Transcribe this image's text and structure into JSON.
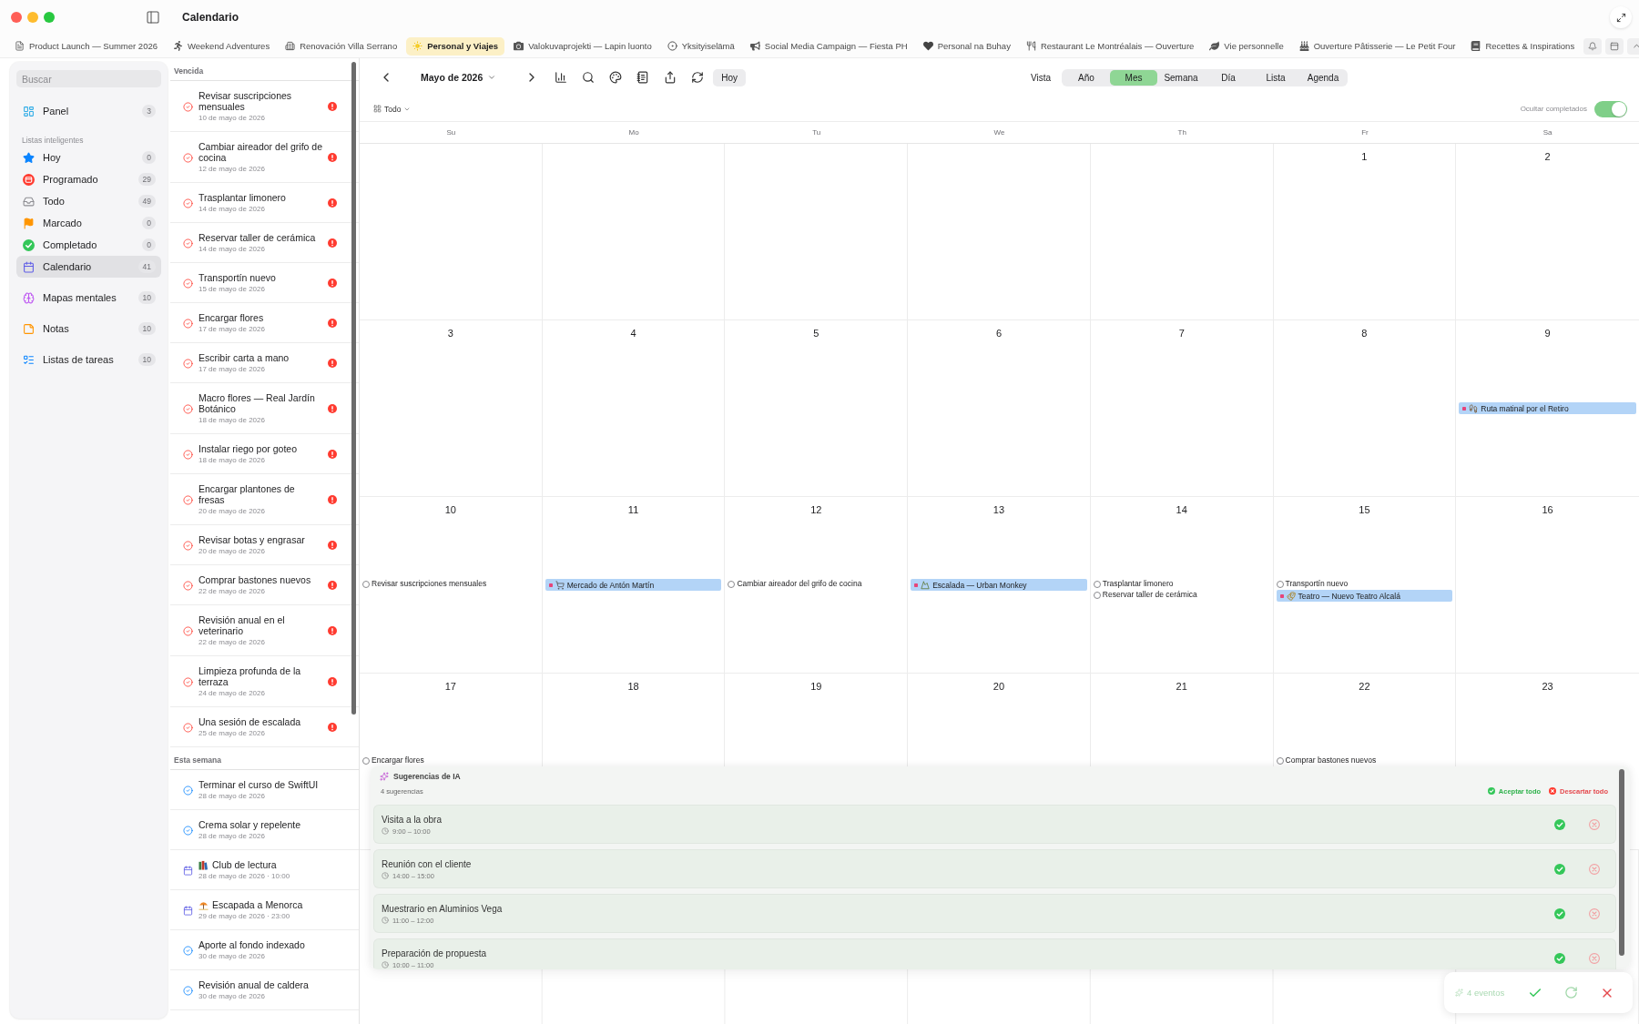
{
  "window": {
    "title": "Calendario"
  },
  "tabs": [
    {
      "label": "Product Launch — Summer 2026",
      "kind": "document",
      "selected": false
    },
    {
      "label": "Weekend Adventures",
      "kind": "runner",
      "selected": false
    },
    {
      "label": "Renovación Villa Serrano",
      "kind": "house",
      "selected": false
    },
    {
      "label": "Personal y Viajes",
      "kind": "sun",
      "selected": true
    },
    {
      "label": "Valokuvaprojekti — Lapin luonto",
      "kind": "camera",
      "selected": false
    },
    {
      "label": "Yksityiselämä",
      "kind": "circle",
      "selected": false
    },
    {
      "label": "Social Media Campaign — Fiesta PH",
      "kind": "megaphone",
      "selected": false
    },
    {
      "label": "Personal na Buhay",
      "kind": "heart",
      "selected": false
    },
    {
      "label": "Restaurant Le Montréalais — Ouverture",
      "kind": "cutlery",
      "selected": false
    },
    {
      "label": "Vie personnelle",
      "kind": "leaf",
      "selected": false
    },
    {
      "label": "Ouverture Pâtisserie — Le Petit Four",
      "kind": "cake",
      "selected": false
    },
    {
      "label": "Recettes & Inspirations",
      "kind": "book",
      "selected": false
    }
  ],
  "sidebar": {
    "search": {
      "placeholder": "Buscar"
    },
    "groups": [
      {
        "items": [
          {
            "label": "Panel",
            "count": "3",
            "kind": "dashboard",
            "selected": false
          }
        ]
      },
      {
        "heading": "Listas inteligentes",
        "items": [
          {
            "label": "Hoy",
            "count": "0",
            "kind": "today",
            "selected": false
          },
          {
            "label": "Programado",
            "count": "29",
            "kind": "scheduled",
            "selected": false
          },
          {
            "label": "Todo",
            "count": "49",
            "kind": "all",
            "selected": false
          },
          {
            "label": "Marcado",
            "count": "0",
            "kind": "flagged",
            "selected": false
          },
          {
            "label": "Completado",
            "count": "0",
            "kind": "completed",
            "selected": false
          },
          {
            "label": "Calendario",
            "count": "41",
            "kind": "calendar",
            "selected": true
          }
        ]
      },
      {
        "items": [
          {
            "label": "Mapas mentales",
            "count": "10",
            "kind": "mindmaps",
            "selected": false
          },
          {
            "label": "Notas",
            "count": "10",
            "kind": "notes",
            "selected": false
          },
          {
            "label": "Listas de tareas",
            "count": "10",
            "kind": "tasklists",
            "selected": false
          }
        ]
      }
    ]
  },
  "task_list": {
    "sections": [
      {
        "heading": "Vencida",
        "items": [
          {
            "title": "Revisar suscripciones mensuales",
            "date": "10 de mayo de 2026",
            "kind": "task",
            "overdue": true
          },
          {
            "title": "Cambiar aireador del grifo de cocina",
            "date": "12 de mayo de 2026",
            "kind": "task",
            "overdue": true
          },
          {
            "title": "Trasplantar limonero",
            "date": "14 de mayo de 2026",
            "kind": "task",
            "overdue": true
          },
          {
            "title": "Reservar taller de cerámica",
            "date": "14 de mayo de 2026",
            "kind": "task",
            "overdue": true
          },
          {
            "title": "Transportín nuevo",
            "date": "15 de mayo de 2026",
            "kind": "task",
            "overdue": true
          },
          {
            "title": "Encargar flores",
            "date": "17 de mayo de 2026",
            "kind": "task",
            "overdue": true
          },
          {
            "title": "Escribir carta a mano",
            "date": "17 de mayo de 2026",
            "kind": "task",
            "overdue": true
          },
          {
            "title": "Macro flores — Real Jardín Botánico",
            "date": "18 de mayo de 2026",
            "kind": "task",
            "overdue": true
          },
          {
            "title": "Instalar riego por goteo",
            "date": "18 de mayo de 2026",
            "kind": "task",
            "overdue": true
          },
          {
            "title": "Encargar plantones de fresas",
            "date": "20 de mayo de 2026",
            "kind": "task",
            "overdue": true
          },
          {
            "title": "Revisar botas y engrasar",
            "date": "20 de mayo de 2026",
            "kind": "task",
            "overdue": true
          },
          {
            "title": "Comprar bastones nuevos",
            "date": "22 de mayo de 2026",
            "kind": "task",
            "overdue": true
          },
          {
            "title": "Revisión anual en el veterinario",
            "date": "22 de mayo de 2026",
            "kind": "task",
            "overdue": true
          },
          {
            "title": "Limpieza profunda de la terraza",
            "date": "24 de mayo de 2026",
            "kind": "task",
            "overdue": true
          },
          {
            "title": "Una sesión de escalada",
            "date": "25 de mayo de 2026",
            "kind": "task",
            "overdue": true
          }
        ]
      },
      {
        "heading": "Esta semana",
        "items": [
          {
            "title": "Terminar el curso de SwiftUI",
            "date": "28 de mayo de 2026",
            "kind": "task",
            "overdue": false
          },
          {
            "title": "Crema solar y repelente",
            "date": "28 de mayo de 2026",
            "kind": "task",
            "overdue": false
          },
          {
            "title": "Club de lectura",
            "date": "28 de mayo de 2026 · 10:00",
            "kind": "reading",
            "overdue": false
          },
          {
            "title": "Escapada a Menorca",
            "date": "29 de mayo de 2026 · 23:00",
            "kind": "getaway",
            "overdue": false
          },
          {
            "title": "Aporte al fondo indexado",
            "date": "30 de mayo de 2026",
            "kind": "task",
            "overdue": false
          },
          {
            "title": "Revisión anual de caldera",
            "date": "30 de mayo de 2026",
            "kind": "task",
            "overdue": false
          }
        ]
      }
    ]
  },
  "calendar": {
    "toolbar": {
      "month": "Mayo de 2026",
      "today": "Hoy",
      "view_label": "Vista",
      "views": [
        {
          "label": "Año",
          "selected": false
        },
        {
          "label": "Mes",
          "selected": true
        },
        {
          "label": "Semana",
          "selected": false
        },
        {
          "label": "Día",
          "selected": false
        },
        {
          "label": "Lista",
          "selected": false
        },
        {
          "label": "Agenda",
          "selected": false
        }
      ]
    },
    "filter": {
      "label": "Todo"
    },
    "hide_completed": {
      "label": "Ocultar completados",
      "on": true
    },
    "weekdays": [
      "Su",
      "Mo",
      "Tu",
      "We",
      "Th",
      "Fr",
      "Sa"
    ],
    "weeks": [
      [
        {
          "day": "1"
        },
        {
          "day": "2"
        }
      ],
      [
        {
          "day": "3"
        },
        {
          "day": "4"
        },
        {
          "day": "5"
        },
        {
          "day": "6"
        },
        {
          "day": "7"
        },
        {
          "day": "8"
        },
        {
          "day": "9",
          "events": [
            {
              "kind": "walk",
              "title": "Ruta matinal por el Retiro"
            }
          ]
        }
      ],
      [
        {
          "day": "10",
          "events": [
            {
              "kind": "task",
              "title": "Revisar suscripciones mensuales",
              "checked": false
            }
          ]
        },
        {
          "day": "11",
          "events": [
            {
              "kind": "market",
              "title": "Mercado de Antón Martín"
            }
          ]
        },
        {
          "day": "12",
          "events": [
            {
              "kind": "task",
              "title": "Cambiar aireador del grifo de cocina",
              "checked": false
            }
          ]
        },
        {
          "day": "13",
          "events": [
            {
              "kind": "climbing",
              "title": "Escalada — Urban Monkey"
            }
          ]
        },
        {
          "day": "14",
          "events": [
            {
              "kind": "task",
              "title": "Trasplantar limonero",
              "checked": false
            },
            {
              "kind": "task",
              "title": "Reservar taller de cerámica",
              "checked": false
            }
          ]
        },
        {
          "day": "15",
          "events": [
            {
              "kind": "task",
              "title": "Transportín nuevo",
              "checked": false
            },
            {
              "kind": "theater",
              "title": "Teatro — Nuevo Teatro Alcalá"
            }
          ]
        },
        {
          "day": "16"
        }
      ],
      [
        {
          "day": "17",
          "events": [
            {
              "kind": "task",
              "title": "Encargar flores",
              "checked": false
            }
          ]
        },
        {
          "day": "18"
        },
        {
          "day": "19"
        },
        {
          "day": "20"
        },
        {
          "day": "21"
        },
        {
          "day": "22",
          "events": [
            {
              "kind": "task",
              "title": "Comprar bastones nuevos",
              "checked": false
            }
          ]
        },
        {
          "day": "23"
        }
      ]
    ]
  },
  "ai_suggestions": {
    "title": "Sugerencias de IA",
    "count": "4 sugerencias",
    "accept_all": "Aceptar todo",
    "discard_all": "Descartar todo",
    "items": [
      {
        "title": "Visita a la obra",
        "time": "9:00 – 10:00"
      },
      {
        "title": "Reunión con el cliente",
        "time": "14:00 – 15:00"
      },
      {
        "title": "Muestrario en Aluminios Vega",
        "time": "11:00 – 12:00"
      },
      {
        "title": "Preparación de propuesta",
        "time": "10:00 – 11:00"
      }
    ]
  },
  "pending_bar": {
    "label": "4 eventos"
  }
}
